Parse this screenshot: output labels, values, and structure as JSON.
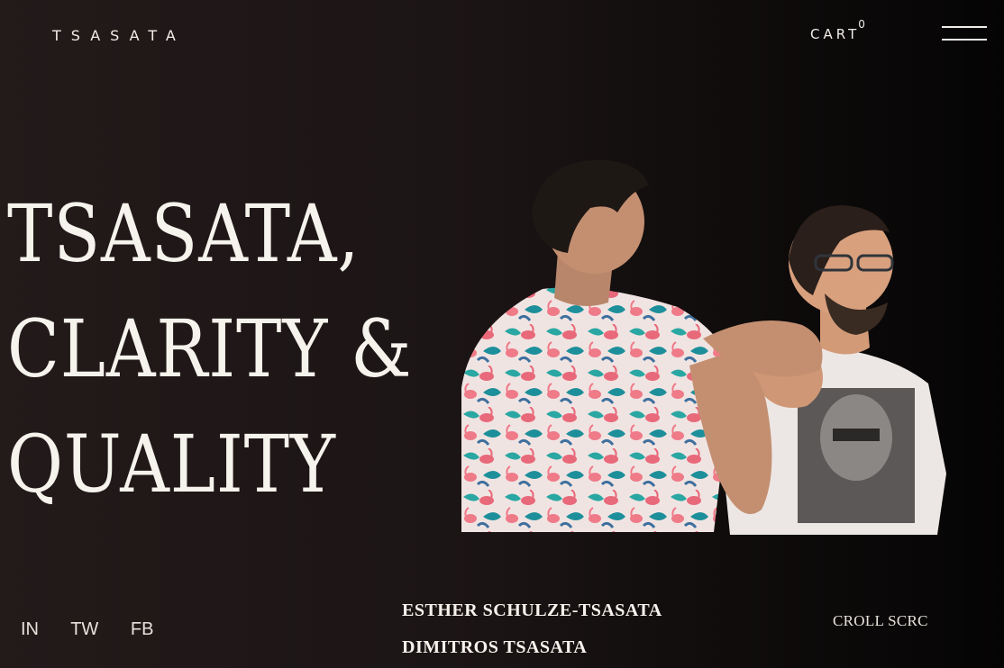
{
  "header": {
    "brand": "TSASATA",
    "cart_label": "CART",
    "cart_count": "0",
    "menu_icon": "hamburger-menu-icon"
  },
  "hero": {
    "title_lines": [
      "TSASATA,",
      "CLARITY &",
      "QUALITY"
    ],
    "photo": "two-founders-photo"
  },
  "footer": {
    "social": [
      "IN",
      "TW",
      "FB"
    ],
    "founders": [
      "ESTHER SCHULZE-TSASATA",
      "DIMITROS TSASATA"
    ],
    "scroll_label": "CROLL SCRC"
  },
  "colors": {
    "background": "#1c1515",
    "text": "#f3efe9"
  }
}
